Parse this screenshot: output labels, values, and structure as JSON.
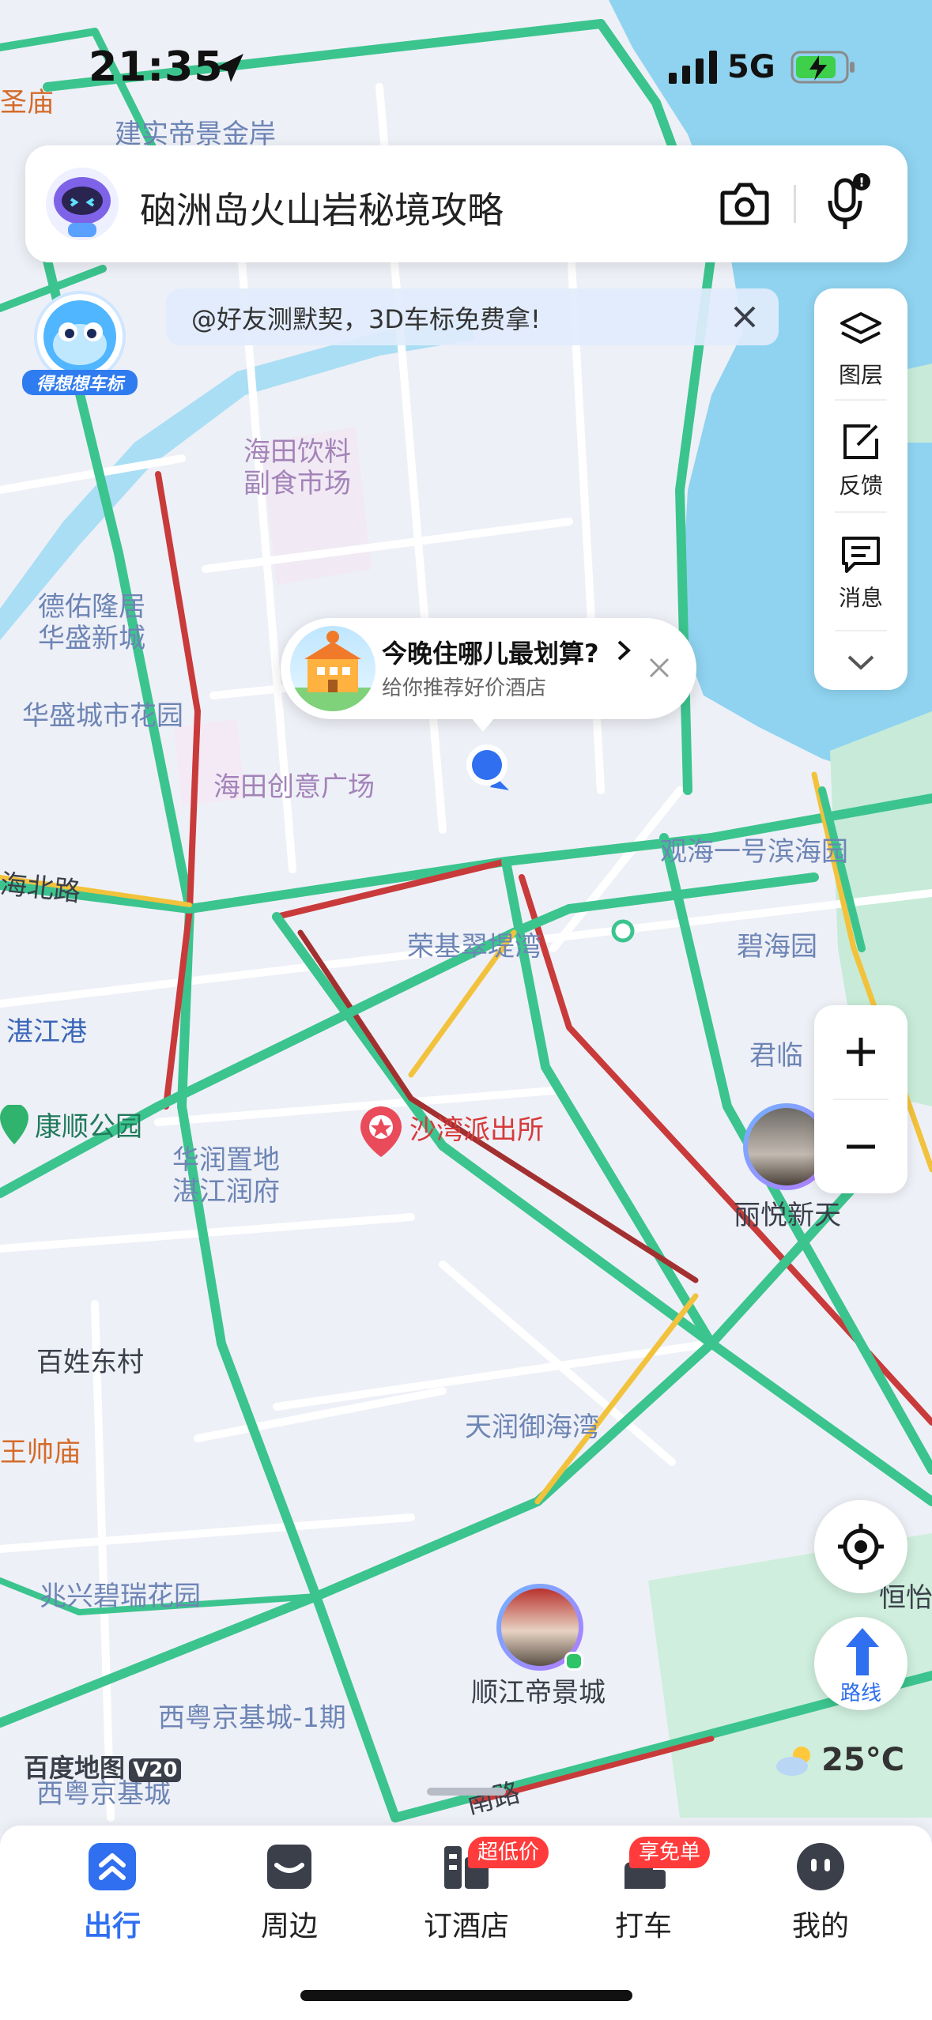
{
  "status_bar": {
    "time": "21:35",
    "network": "5G"
  },
  "search": {
    "query": "硇洲岛火山岩秘境攻略"
  },
  "banner": {
    "text": "@好友测默契，3D车标免费拿!"
  },
  "mascot": {
    "label": "得想想车标"
  },
  "side_panel": {
    "items": [
      {
        "label": "图层"
      },
      {
        "label": "反馈"
      },
      {
        "label": "消息"
      }
    ]
  },
  "hotel_popup": {
    "title": "今晚住哪儿最划算?",
    "subtitle": "给你推荐好价酒店"
  },
  "map_labels": {
    "l1": "建实帝景金岸",
    "l2": "海田饮料",
    "l2b": "副食市场",
    "l3": "德佑隆居",
    "l3b": "华盛新城",
    "l4": "华盛城市花园",
    "l5": "海田创意广场",
    "l6": "海北路",
    "l7": "观海一号滨海园",
    "l8": "荣基翠堤湾",
    "l9": "碧海园",
    "l10": "湛江港",
    "l11": "君临",
    "l12": "康顺公园",
    "l13": "沙湾派出所",
    "l14": "华润置地",
    "l14b": "湛江润府",
    "l15": "丽悦新天",
    "l16": "百姓东村",
    "l17": "王帅庙",
    "l18": "天润御海湾",
    "l19": "恒怡",
    "l20": "兆兴碧瑞花园",
    "l21": "顺江帝景城",
    "l22": "西粤京基城-1期",
    "l23": "西粤京基城",
    "l24": "南路",
    "l25": "圣庙"
  },
  "map_logo": {
    "text": "百度地图",
    "version": "V20"
  },
  "weather": {
    "temp": "25°C"
  },
  "route_button": {
    "label": "路线"
  },
  "tabs": [
    {
      "label": "出行",
      "active": true
    },
    {
      "label": "周边"
    },
    {
      "label": "订酒店",
      "badge": "超低价"
    },
    {
      "label": "打车",
      "badge": "享免单"
    },
    {
      "label": "我的"
    }
  ],
  "colors": {
    "accent": "#2f6ff0",
    "water": "#8fd3f0",
    "road_green": "#3cc48e",
    "road_red": "#c93a3a",
    "road_yellow": "#f2c23c"
  }
}
